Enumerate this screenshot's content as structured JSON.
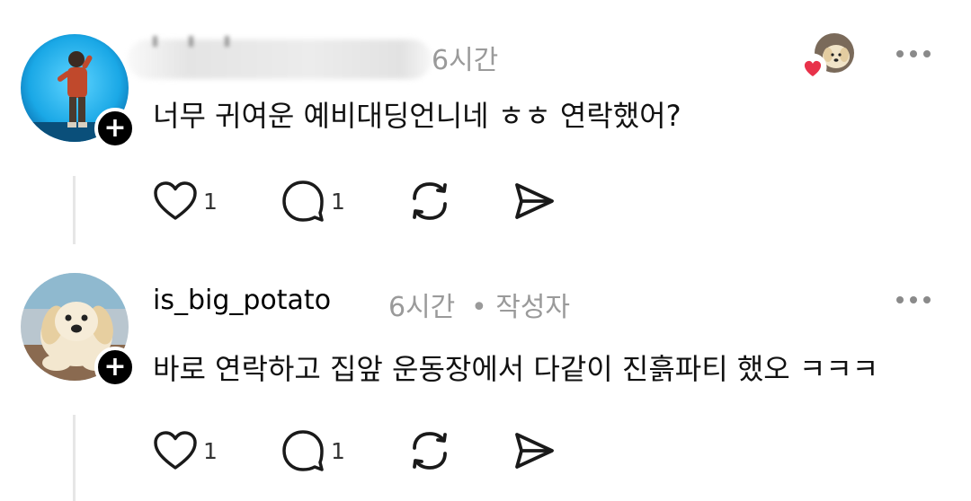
{
  "comments": [
    {
      "username": "",
      "time": "6시간",
      "author_tag": "",
      "text": "너무 귀여운 예비대딩언니네 ㅎㅎ 연락했어?",
      "like_count": "1",
      "reply_count": "1",
      "liked_by_author": true
    },
    {
      "username": "is_big_potato",
      "time": "6시간",
      "author_tag": "• 작성자",
      "text": "바로 연락하고 집앞 운동장에서 다같이 진흙파티 했오 ㅋㅋㅋ",
      "like_count": "1",
      "reply_count": "1",
      "liked_by_author": false
    }
  ],
  "icons": {
    "follow": "plus-icon",
    "like": "heart-icon",
    "reply": "comment-icon",
    "repost": "repost-icon",
    "share": "send-icon",
    "more": "more-icon"
  },
  "colors": {
    "heart_badge": "#e8324a",
    "meta_gray": "#9a9a9a"
  }
}
